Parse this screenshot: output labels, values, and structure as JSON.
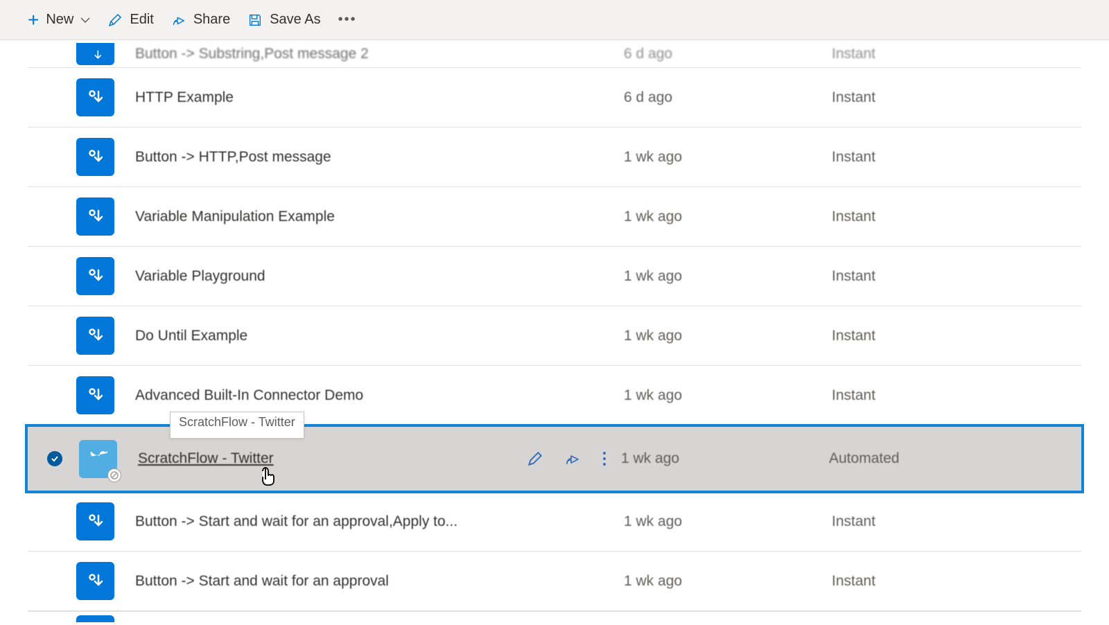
{
  "toolbar": {
    "new": "New",
    "edit": "Edit",
    "share": "Share",
    "saveas": "Save As"
  },
  "rows": {
    "r0": {
      "name": "Button -> Substring,Post message 2",
      "mod": "6 d ago",
      "type": "Instant"
    },
    "r1": {
      "name": "HTTP Example",
      "mod": "6 d ago",
      "type": "Instant"
    },
    "r2": {
      "name": "Button -> HTTP,Post message",
      "mod": "1 wk ago",
      "type": "Instant"
    },
    "r3": {
      "name": "Variable Manipulation Example",
      "mod": "1 wk ago",
      "type": "Instant"
    },
    "r4": {
      "name": "Variable Playground",
      "mod": "1 wk ago",
      "type": "Instant"
    },
    "r5": {
      "name": "Do Until Example",
      "mod": "1 wk ago",
      "type": "Instant"
    },
    "r6": {
      "name": "Advanced Built-In Connector Demo",
      "mod": "1 wk ago",
      "type": "Instant"
    },
    "r7": {
      "name": "ScratchFlow - Twitter",
      "mod": "1 wk ago",
      "type": "Automated",
      "tooltip": "ScratchFlow - Twitter"
    },
    "r8": {
      "name": "Button -> Start and wait for an approval,Apply to...",
      "mod": "1 wk ago",
      "type": "Instant"
    },
    "r9": {
      "name": "Button -> Start and wait for an approval",
      "mod": "1 wk ago",
      "type": "Instant"
    }
  }
}
